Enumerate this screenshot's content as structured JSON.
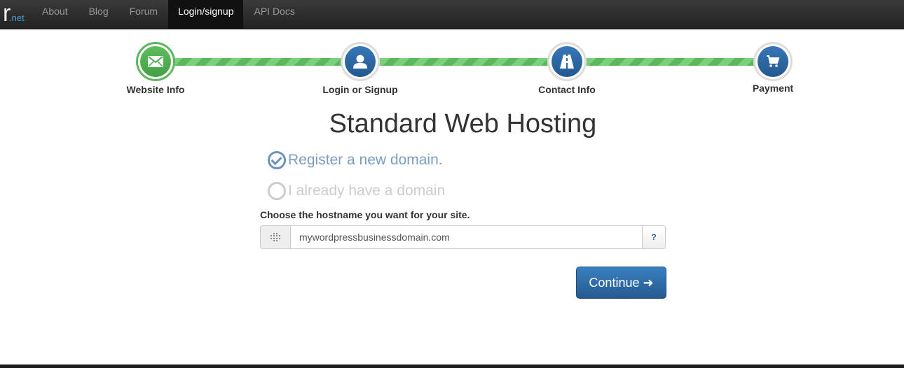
{
  "navbar": {
    "brand_main": "r",
    "brand_sub": ".net",
    "items": [
      {
        "label": "About",
        "active": false
      },
      {
        "label": "Blog",
        "active": false
      },
      {
        "label": "Forum",
        "active": false
      },
      {
        "label": "Login/signup",
        "active": true
      },
      {
        "label": "API Docs",
        "active": false
      }
    ]
  },
  "steps": [
    {
      "label": "Website Info",
      "icon": "envelope-icon",
      "status": "done"
    },
    {
      "label": "Login or Signup",
      "icon": "user-icon",
      "status": "current"
    },
    {
      "label": "Contact Info",
      "icon": "road-icon",
      "status": "pending"
    },
    {
      "label": "Payment",
      "icon": "cart-icon",
      "status": "pending"
    }
  ],
  "colors": {
    "success": "#5cb85c",
    "primary": "#2a6aa9"
  },
  "title": "Standard Web Hosting",
  "domain_options": [
    {
      "label": "Register a new domain.",
      "checked": true
    },
    {
      "label": "I already have a domain",
      "checked": false
    }
  ],
  "hostname": {
    "label": "Choose the hostname you want for your site.",
    "value": "mywordpressbusinessdomain.com",
    "help": "?"
  },
  "continue_button": {
    "label": "Continue",
    "arrow": "➜"
  }
}
